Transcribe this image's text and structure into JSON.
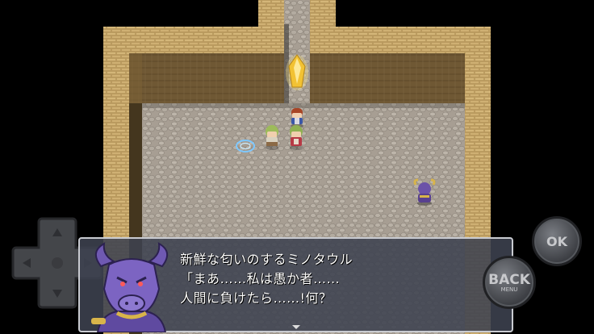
{
  "dialogue": {
    "speaker_line": "新鮮な匂いのするミノタウル",
    "line2": "「まあ……私は愚か者……",
    "line3": "人間に負けたら……!何？"
  },
  "controls": {
    "ok_label": "OK",
    "back_label": "BACK",
    "back_sub_label": "MENU"
  },
  "icons": {
    "dpad": "dpad-icon",
    "crystal": "crystal-icon",
    "portrait": "minotaur-portrait"
  },
  "colors": {
    "wall": "#c8a867",
    "wall_shadow": "#6e5632",
    "floor": "#a9a096",
    "dialog_bg": "#3e4250"
  }
}
